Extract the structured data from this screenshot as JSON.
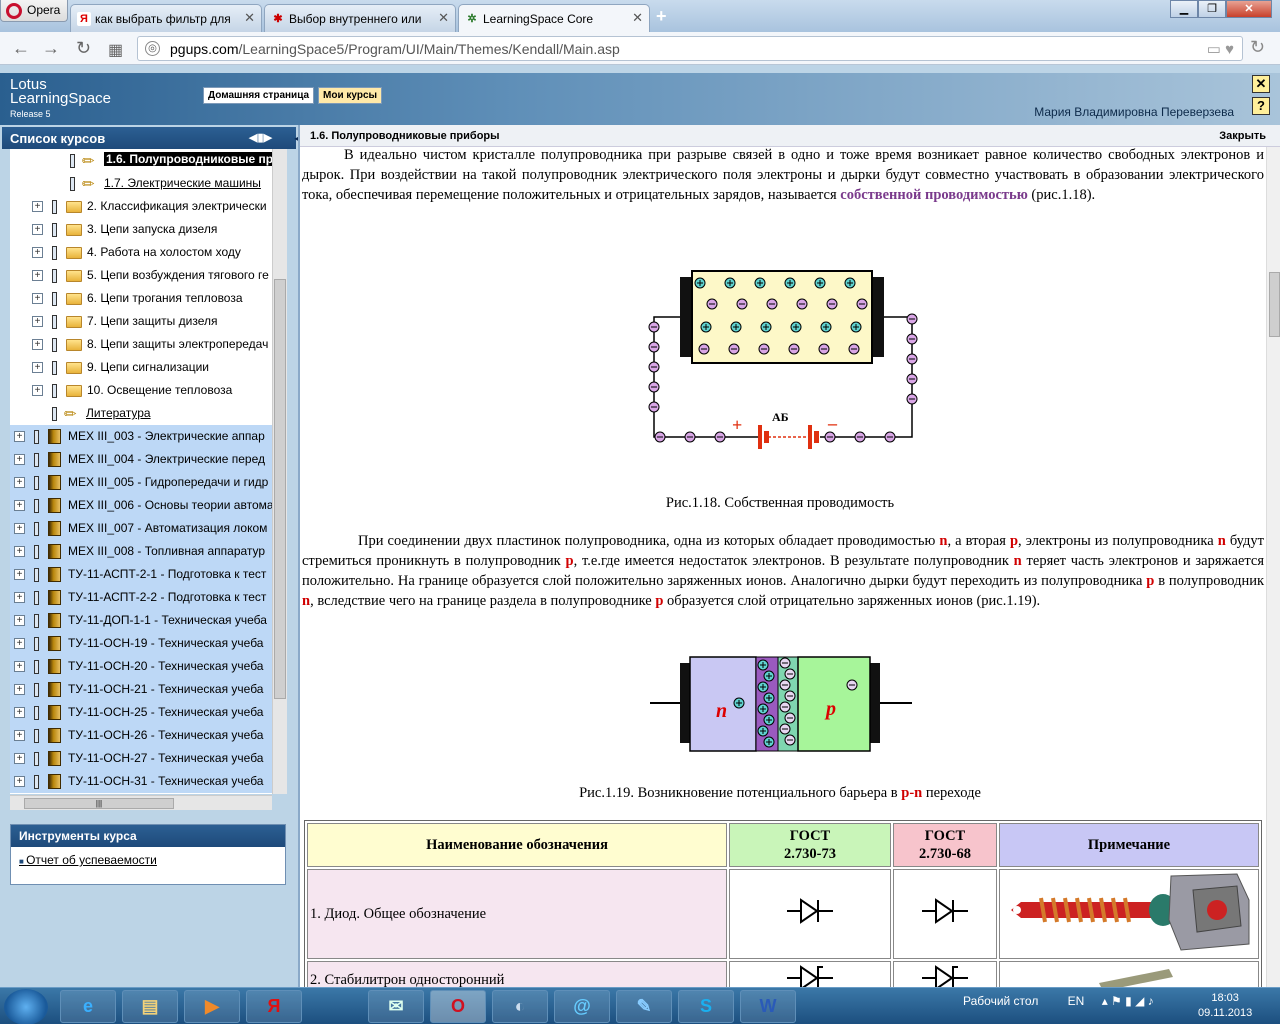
{
  "browser": {
    "menu_label": "Opera",
    "tabs": [
      {
        "title": "как выбрать фильтр для",
        "icon": "Я"
      },
      {
        "title": "Выбор внутреннего или",
        "icon": "✱"
      },
      {
        "title": "LearningSpace Core",
        "icon": "✲"
      }
    ],
    "new_tab": "+",
    "url_host": "pgups.com",
    "url_path": "/LearningSpace5/Program/UI/Main/Themes/Kendall/Main.asp"
  },
  "ls": {
    "logo_line1": "Lotus",
    "logo_line2": "LearningSpace",
    "logo_line3": "Release 5",
    "nav": [
      "Домашняя страница",
      "Мои курсы"
    ],
    "user": "Мария Владимировна Переверзева",
    "close_btn": "✕",
    "help_btn": "?"
  },
  "left": {
    "title": "Список курсов",
    "tree": [
      {
        "label": "1.6. Полупроводниковые пр",
        "kind": "pen",
        "state": "hl"
      },
      {
        "label": "1.7. Электрические машины",
        "kind": "pen",
        "state": "link"
      },
      {
        "label": "2. Классификация электрически",
        "kind": "folder"
      },
      {
        "label": "3. Цепи запуска дизеля",
        "kind": "folder"
      },
      {
        "label": "4. Работа на холостом ходу",
        "kind": "folder"
      },
      {
        "label": "5. Цепи возбуждения тягового ге",
        "kind": "folder"
      },
      {
        "label": "6. Цепи трогания тепловоза",
        "kind": "folder"
      },
      {
        "label": "7. Цепи защиты дизеля",
        "kind": "folder"
      },
      {
        "label": "8. Цепи защиты электропередач",
        "kind": "folder"
      },
      {
        "label": "9. Цепи сигнализации",
        "kind": "folder"
      },
      {
        "label": "10. Освещение тепловоза",
        "kind": "folder"
      },
      {
        "label": "Литература",
        "kind": "pen-link"
      },
      {
        "label": "МЕХ III_003 - Электрические аппар",
        "kind": "course"
      },
      {
        "label": "МЕХ III_004 - Электрические перед",
        "kind": "course"
      },
      {
        "label": "МЕХ III_005 - Гидропередачи и гидр",
        "kind": "course"
      },
      {
        "label": "МЕХ III_006 - Основы теории автома",
        "kind": "course"
      },
      {
        "label": "МЕХ III_007 - Автоматизация локом",
        "kind": "course"
      },
      {
        "label": "МЕХ III_008 - Топливная аппаратур",
        "kind": "course"
      },
      {
        "label": "ТУ-11-АСПТ-2-1 - Подготовка к тест",
        "kind": "course"
      },
      {
        "label": "ТУ-11-АСПТ-2-2 - Подготовка к тест",
        "kind": "course"
      },
      {
        "label": "ТУ-11-ДОП-1-1 - Техническая учеба",
        "kind": "course"
      },
      {
        "label": "ТУ-11-ОСН-19 - Техническая учеба",
        "kind": "course"
      },
      {
        "label": "ТУ-11-ОСН-20 - Техническая учеба",
        "kind": "course"
      },
      {
        "label": "ТУ-11-ОСН-21 - Техническая учеба",
        "kind": "course"
      },
      {
        "label": "ТУ-11-ОСН-25 - Техническая учеба",
        "kind": "course"
      },
      {
        "label": "ТУ-11-ОСН-26 - Техническая учеба",
        "kind": "course"
      },
      {
        "label": "ТУ-11-ОСН-27 - Техническая учеба",
        "kind": "course"
      },
      {
        "label": "ТУ-11-ОСН-31 - Техническая учеба",
        "kind": "course"
      }
    ],
    "tools_title": "Инструменты курса",
    "tools_item": "Отчет об успеваемости"
  },
  "content": {
    "title": "1.6. Полупроводниковые приборы",
    "close": "Закрыть",
    "para1_a": "В идеально чистом кристалле полупроводника при разрыве связей в одно и тоже время возникает равное количество свободных электронов и дырок. При воздействии на такой полупроводник электрического поля электроны и дырки будут совместно участвовать в образовании электрического тока, обеспечивая перемещение положительных и отрицательных зарядов, называется ",
    "para1_term": "собственной проводимостью",
    "para1_b": " (рис.1.18).",
    "battery_label": "АБ",
    "fig18_caption": "Рис.1.18. Собственная проводимость",
    "p2_1": "При соединении двух пластинок полупроводника, одна из которых обладает проводимостью ",
    "n": "n",
    "p": "p",
    "p2_2": ", а вторая ",
    "p2_3": ", электроны из полупроводника ",
    "p2_4": " будут стремиться проникнуть в полупроводник ",
    "p2_5": ", т.е.где имеется недостаток электронов. В результате полупроводник ",
    "p2_6": " теряет часть электронов и заряжается положительно. На границе образуется слой положительно заряженных ионов. Аналогично дырки будут переходить из полупроводника ",
    "p2_7": " в полупроводник ",
    "p2_8": ", вследствие чего на границе раздела в полупроводнике ",
    "p2_9": " образуется слой отрицательно заряженных ионов (рис.1.19).",
    "fig19_caption_a": "Рис.1.19. Возникновение потенциального барьера в ",
    "fig19_caption_pn": "p-n",
    "fig19_caption_b": " переходе",
    "table_head": {
      "name": "Наименование обозначения",
      "gost1": "ГОСТ",
      "gost1_num": "2.730-73",
      "gost2": "ГОСТ",
      "gost2_num": "2.730-68",
      "note": "Примечание"
    },
    "table_rows": [
      "1. Диод. Общее обозначение",
      "2. Стабилитрон односторонний"
    ]
  },
  "taskbar": {
    "desktop": "Рабочий стол",
    "lang": "EN",
    "time": "18:03",
    "date": "09.11.2013"
  }
}
